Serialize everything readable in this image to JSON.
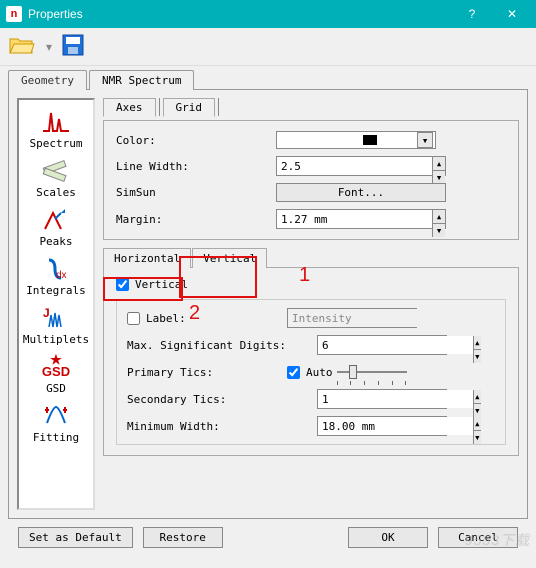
{
  "window": {
    "title": "Properties",
    "help_glyph": "?",
    "close_glyph": "✕"
  },
  "tabs_outer": {
    "geometry": "Geometry",
    "nmr": "NMR Spectrum"
  },
  "side": {
    "spectrum": "Spectrum",
    "scales": "Scales",
    "peaks": "Peaks",
    "integrals": "Integrals",
    "multiplets": "Multiplets",
    "gsd": "GSD",
    "fitting": "Fitting"
  },
  "subtabs": {
    "axes": "Axes",
    "grid": "Grid"
  },
  "group1": {
    "color_label": "Color:",
    "color_value": "#000000",
    "linewidth_label": "Line Width:",
    "linewidth_value": "2.5",
    "font_family": "SimSun",
    "font_button": "Font...",
    "margin_label": "Margin:",
    "margin_value": "1.27 mm"
  },
  "subtabs2": {
    "horizontal": "Horizontal",
    "vertical": "Vertical"
  },
  "group2": {
    "vertical_check": "Vertical",
    "vertical_checked": true,
    "label_check": "Label:",
    "label_checked": false,
    "label_value": "Intensity",
    "maxdigits_label": "Max. Significant Digits:",
    "maxdigits_value": "6",
    "primary_label": "Primary Tics:",
    "auto_check": "Auto",
    "auto_checked": true,
    "secondary_label": "Secondary Tics:",
    "secondary_value": "1",
    "minwidth_label": "Minimum Width:",
    "minwidth_value": "18.00 mm"
  },
  "annotations": {
    "one": "1",
    "two": "2"
  },
  "footer": {
    "set_default": "Set as Default",
    "restore": "Restore",
    "ok": "OK",
    "cancel": "Cancel"
  },
  "watermark": "9553下载"
}
